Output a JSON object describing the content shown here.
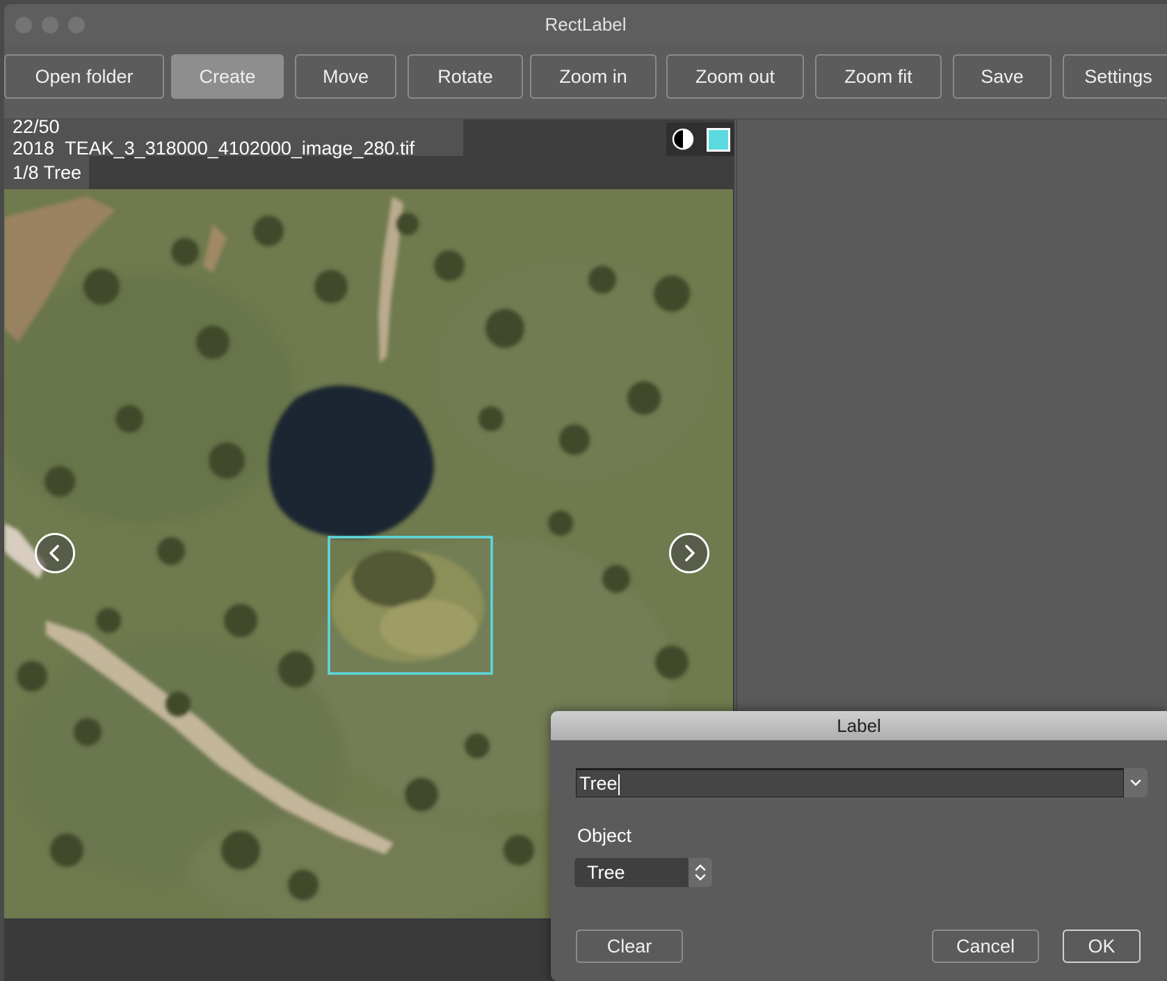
{
  "window": {
    "title": "RectLabel"
  },
  "toolbar": {
    "buttons": [
      {
        "label": "Open folder",
        "active": false
      },
      {
        "label": "Create",
        "active": true
      },
      {
        "label": "Move",
        "active": false
      },
      {
        "label": "Rotate",
        "active": false
      },
      {
        "label": "Zoom in",
        "active": false
      },
      {
        "label": "Zoom out",
        "active": false
      },
      {
        "label": "Zoom fit",
        "active": false
      },
      {
        "label": "Save",
        "active": false
      },
      {
        "label": "Settings",
        "active": false
      }
    ]
  },
  "image_view": {
    "file_info": "22/50 2018_TEAK_3_318000_4102000_image_280.tif",
    "object_info": "1/8 Tree",
    "box_color": "#5cd9de",
    "prev_icon": "chevron-left-icon",
    "next_icon": "chevron-right-icon",
    "contrast_icon": "contrast-icon"
  },
  "label_dialog": {
    "title": "Label",
    "label_value": "Tree",
    "object_heading": "Object",
    "object_selected": "Tree",
    "clear_label": "Clear",
    "cancel_label": "Cancel",
    "ok_label": "OK"
  }
}
